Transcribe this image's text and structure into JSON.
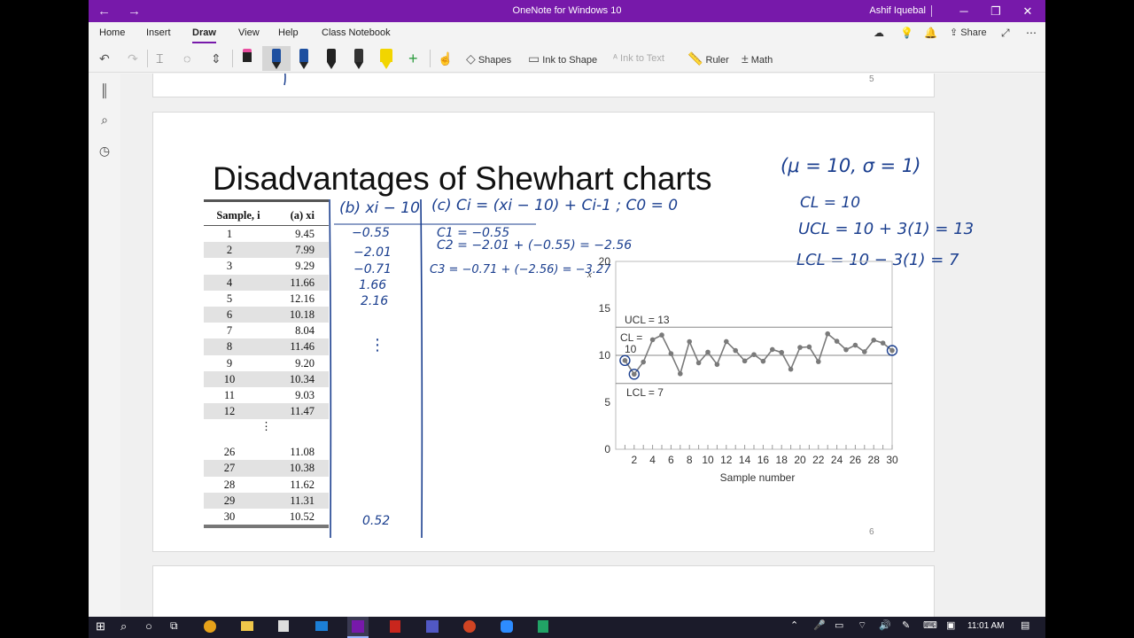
{
  "window": {
    "back_glyph": "←",
    "forward_glyph": "→",
    "title": "OneNote for Windows 10",
    "user": "Ashif Iquebal",
    "min_glyph": "─",
    "restore_glyph": "❐",
    "close_glyph": "✕"
  },
  "ribbon": {
    "tabs": [
      "Home",
      "Insert",
      "Draw",
      "View",
      "Help",
      "Class Notebook"
    ],
    "active_tab": "Draw",
    "share_label": "Share",
    "more_glyph": "⋯"
  },
  "toolbar": {
    "shapes_label": "Shapes",
    "ink_to_shape_label": "Ink to Shape",
    "ink_to_text_label": "Ink to Text",
    "ruler_label": "Ruler",
    "math_label": "Math",
    "add_pen_glyph": "+"
  },
  "pages": {
    "prev_number": "5",
    "current_number": "6"
  },
  "slide": {
    "title": "Disadvantages of Shewhart charts",
    "table": {
      "header_sample": "Sample, i",
      "header_value": "(a) xi",
      "rows_top": [
        [
          "1",
          "9.45"
        ],
        [
          "2",
          "7.99"
        ],
        [
          "3",
          "9.29"
        ],
        [
          "4",
          "11.66"
        ],
        [
          "5",
          "12.16"
        ],
        [
          "6",
          "10.18"
        ],
        [
          "7",
          "8.04"
        ],
        [
          "8",
          "11.46"
        ],
        [
          "9",
          "9.20"
        ],
        [
          "10",
          "10.34"
        ],
        [
          "11",
          "9.03"
        ],
        [
          "12",
          "11.47"
        ]
      ],
      "ellipsis": "⋮",
      "rows_bottom": [
        [
          "26",
          "11.08"
        ],
        [
          "27",
          "10.38"
        ],
        [
          "28",
          "11.62"
        ],
        [
          "29",
          "11.31"
        ],
        [
          "30",
          "10.52"
        ]
      ]
    },
    "handwritten": {
      "col_b_header": "(b) xi − 10",
      "col_c_header": "(c) Ci = (xi − 10) + Ci-1 ; C0 = 0",
      "col_b_values": [
        "−0.55",
        "−2.01",
        "−0.71",
        "1.66",
        "2.16"
      ],
      "col_b_dots": "⋮",
      "col_b_last": "0.52",
      "col_c_lines": [
        "C1 = −0.55",
        "C2 = −2.01 + (−0.55) = −2.56",
        "C3 = −0.71 + (−2.56) = −3.27"
      ],
      "params": "(μ = 10, σ = 1)",
      "cl": "CL = 10",
      "ucl": "UCL = 10 + 3(1) = 13",
      "lcl": "LCL = 10 − 3(1) = 7"
    }
  },
  "chart_data": {
    "type": "line",
    "xlabel": "Sample number",
    "ylabel": "x",
    "xlim": [
      0,
      30
    ],
    "ylim": [
      0,
      20
    ],
    "xticks": [
      2,
      4,
      6,
      8,
      10,
      12,
      14,
      16,
      18,
      20,
      22,
      24,
      26,
      28,
      30
    ],
    "yticks": [
      0,
      5,
      10,
      15,
      20
    ],
    "x": [
      1,
      2,
      3,
      4,
      5,
      6,
      7,
      8,
      9,
      10,
      11,
      12,
      13,
      14,
      15,
      16,
      17,
      18,
      19,
      20,
      21,
      22,
      23,
      24,
      25,
      26,
      27,
      28,
      29,
      30
    ],
    "values": [
      9.45,
      7.99,
      9.29,
      11.66,
      12.16,
      10.18,
      8.04,
      11.46,
      9.2,
      10.34,
      9.03,
      11.47,
      10.51,
      9.4,
      10.08,
      9.37,
      10.62,
      10.31,
      8.52,
      10.84,
      10.9,
      9.33,
      12.29,
      11.5,
      10.6,
      11.08,
      10.38,
      11.62,
      11.31,
      10.52
    ],
    "lines": [
      {
        "name": "UCL = 13",
        "value": 13
      },
      {
        "name": "CL = 10",
        "value": 10
      },
      {
        "name": "LCL = 7",
        "value": 7
      }
    ],
    "colors": {
      "series": "#7a7a7a",
      "limits": "#888888",
      "annotation": "#1b3f8f"
    }
  },
  "taskbar": {
    "time": "11:01 AM"
  }
}
